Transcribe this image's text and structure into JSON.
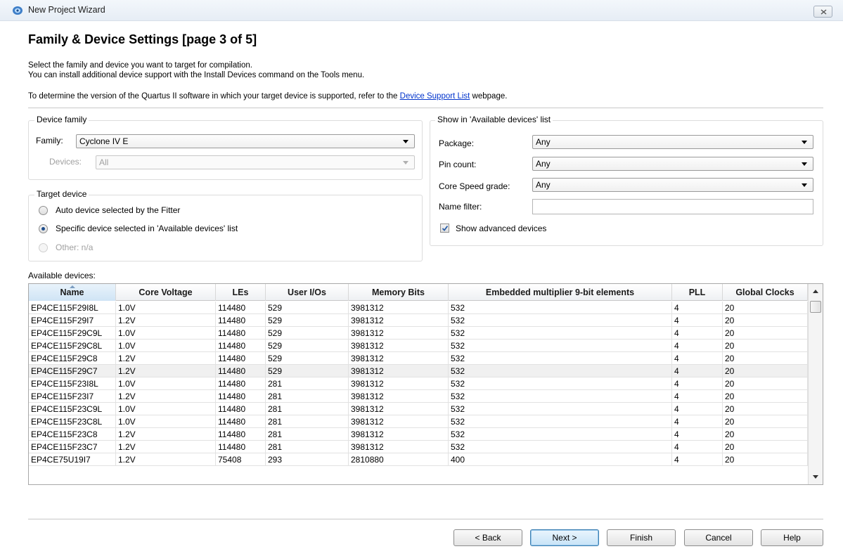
{
  "window": {
    "title": "New Project Wizard"
  },
  "page": {
    "title": "Family & Device Settings [page 3 of 5]",
    "desc_line1": "Select the family and device you want to target for compilation.",
    "desc_line2": "You can install additional device support with the Install Devices command on the Tools menu.",
    "desc_line3_prefix": "To determine the version of the Quartus II software in which your target device is supported, refer to the ",
    "desc_line3_link": "Device Support List",
    "desc_line3_suffix": " webpage."
  },
  "device_family": {
    "legend": "Device family",
    "family_label": "Family:",
    "family_value": "Cyclone IV E",
    "devices_label": "Devices:",
    "devices_value": "All"
  },
  "target_device": {
    "legend": "Target device",
    "options": [
      {
        "label": "Auto device selected by the Fitter",
        "checked": false,
        "disabled": false
      },
      {
        "label": "Specific device selected in 'Available devices' list",
        "checked": true,
        "disabled": false
      },
      {
        "label": "Other:  n/a",
        "checked": false,
        "disabled": true
      }
    ]
  },
  "show_filter": {
    "legend": "Show in 'Available devices' list",
    "package_label": "Package:",
    "package_value": "Any",
    "pin_count_label": "Pin count:",
    "pin_count_value": "Any",
    "speed_label": "Core Speed grade:",
    "speed_value": "Any",
    "name_filter_label": "Name filter:",
    "name_filter_value": "",
    "show_advanced_label": "Show advanced devices",
    "show_advanced_checked": true
  },
  "available": {
    "label": "Available devices:",
    "columns": [
      "Name",
      "Core Voltage",
      "LEs",
      "User I/Os",
      "Memory Bits",
      "Embedded multiplier 9-bit elements",
      "PLL",
      "Global Clocks"
    ],
    "rows": [
      [
        "EP4CE115F29I8L",
        "1.0V",
        "114480",
        "529",
        "3981312",
        "532",
        "4",
        "20"
      ],
      [
        "EP4CE115F29I7",
        "1.2V",
        "114480",
        "529",
        "3981312",
        "532",
        "4",
        "20"
      ],
      [
        "EP4CE115F29C9L",
        "1.0V",
        "114480",
        "529",
        "3981312",
        "532",
        "4",
        "20"
      ],
      [
        "EP4CE115F29C8L",
        "1.0V",
        "114480",
        "529",
        "3981312",
        "532",
        "4",
        "20"
      ],
      [
        "EP4CE115F29C8",
        "1.2V",
        "114480",
        "529",
        "3981312",
        "532",
        "4",
        "20"
      ],
      [
        "EP4CE115F29C7",
        "1.2V",
        "114480",
        "529",
        "3981312",
        "532",
        "4",
        "20"
      ],
      [
        "EP4CE115F23I8L",
        "1.0V",
        "114480",
        "281",
        "3981312",
        "532",
        "4",
        "20"
      ],
      [
        "EP4CE115F23I7",
        "1.2V",
        "114480",
        "281",
        "3981312",
        "532",
        "4",
        "20"
      ],
      [
        "EP4CE115F23C9L",
        "1.0V",
        "114480",
        "281",
        "3981312",
        "532",
        "4",
        "20"
      ],
      [
        "EP4CE115F23C8L",
        "1.0V",
        "114480",
        "281",
        "3981312",
        "532",
        "4",
        "20"
      ],
      [
        "EP4CE115F23C8",
        "1.2V",
        "114480",
        "281",
        "3981312",
        "532",
        "4",
        "20"
      ],
      [
        "EP4CE115F23C7",
        "1.2V",
        "114480",
        "281",
        "3981312",
        "532",
        "4",
        "20"
      ],
      [
        "EP4CE75U19I7",
        "1.2V",
        "75408",
        "293",
        "2810880",
        "400",
        "4",
        "20"
      ]
    ],
    "highlighted_row": 5
  },
  "buttons": {
    "back": "< Back",
    "next": "Next >",
    "finish": "Finish",
    "cancel": "Cancel",
    "help": "Help"
  }
}
